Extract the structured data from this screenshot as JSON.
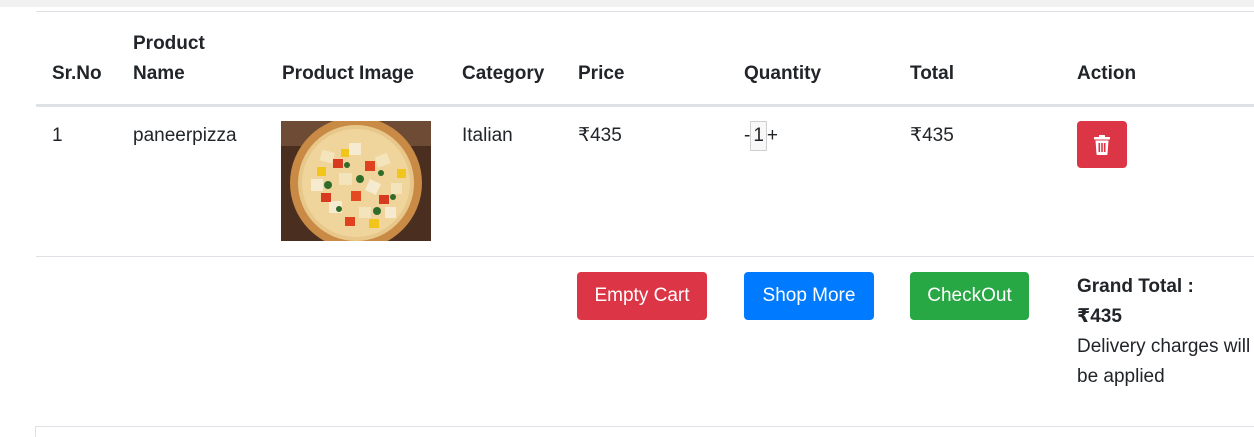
{
  "table": {
    "headers": {
      "srno": "Sr.No",
      "name": "Product Name",
      "image": "Product Image",
      "category": "Category",
      "price": "Price",
      "quantity": "Quantity",
      "total": "Total",
      "action": "Action"
    },
    "rows": [
      {
        "srno": "1",
        "name": "paneerpizza",
        "image_icon": "pizza-photo",
        "category": "Italian",
        "price": "₹435",
        "qty_minus": "-",
        "qty_value": "1",
        "qty_plus": "+",
        "total": "₹435",
        "action_icon": "trash-icon"
      }
    ]
  },
  "footer": {
    "empty_cart_label": "Empty Cart",
    "shop_more_label": "Shop More",
    "checkout_label": "CheckOut",
    "grand_total_label": "Grand Total :",
    "grand_total_value": "₹435",
    "delivery_note": "Delivery charges will be applied"
  },
  "colors": {
    "danger": "#dc3545",
    "primary": "#007bff",
    "success": "#28a745",
    "border": "#dee2e6"
  }
}
